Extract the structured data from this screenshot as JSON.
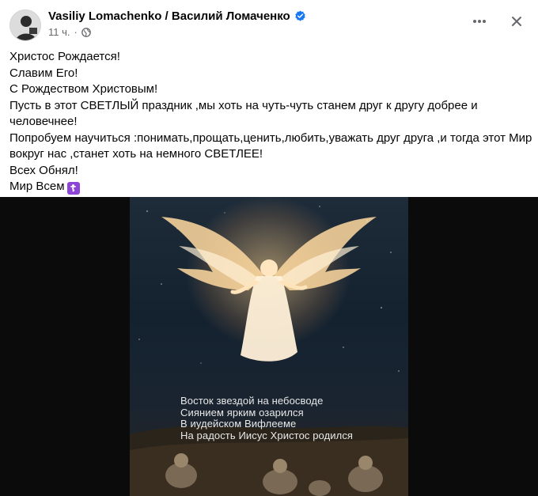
{
  "post": {
    "author": "Vasiliy Lomachenko / Василий Ломаченко",
    "timestamp": "11 ч.",
    "separator": "·",
    "privacy_icon": "globe-icon",
    "text_lines": [
      "Христос Рождается!",
      "Славим Его!",
      "С Рождеством Христовым!",
      "Пусть в этот СВЕТЛЫЙ праздник ,мы хоть на чуть-чуть станем друг к другу добрее и",
      "человечнее!",
      "Попробуем научиться :понимать,прощать,ценить,любить,уважать друг друга ,и тогда этот Мир",
      "вокруг нас ,станет хоть на немного СВЕТЛЕЕ!",
      "Всех Обнял!",
      "Мир Всем"
    ],
    "emoji": "☦"
  },
  "media": {
    "poem_lines": [
      "Восток звездой на небосводе",
      "Сиянием ярким озарился",
      "В иудейском Вифлееме",
      "На радость Иисус Христос родился"
    ]
  },
  "colors": {
    "verified": "#1877f2",
    "meta_text": "#65676b",
    "media_bg": "#0b0b0b"
  }
}
